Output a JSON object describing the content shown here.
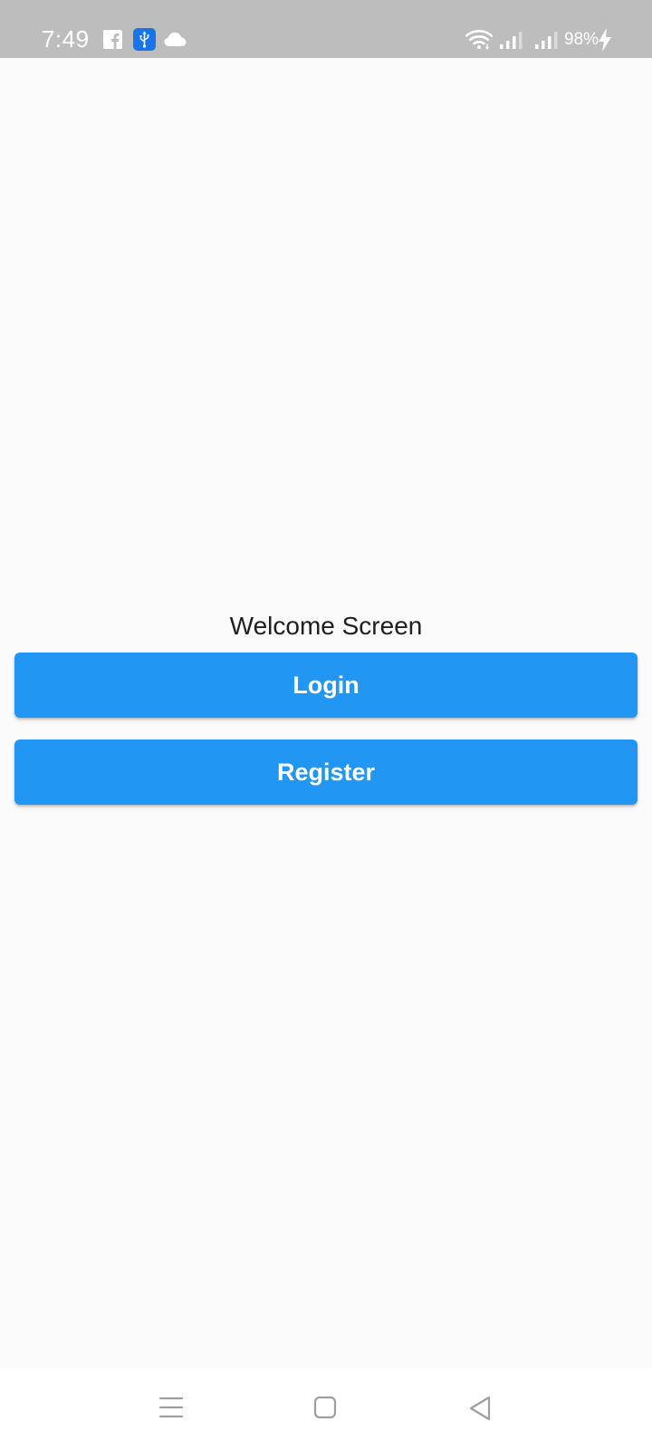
{
  "status_bar": {
    "time": "7:49",
    "battery_percent": "98%",
    "icons": [
      "facebook-icon",
      "usb-icon",
      "cloud-icon",
      "wifi-icon",
      "signal-icon",
      "signal-icon",
      "charging-bolt-icon"
    ],
    "background_color": "#bdbdbd"
  },
  "main": {
    "title": "Welcome Screen",
    "buttons": {
      "login_label": "Login",
      "register_label": "Register"
    },
    "accent_color": "#2196f3",
    "background_color": "#fafafa"
  },
  "nav_bar": {
    "icons": [
      "menu-icon",
      "home-icon",
      "back-icon"
    ]
  }
}
